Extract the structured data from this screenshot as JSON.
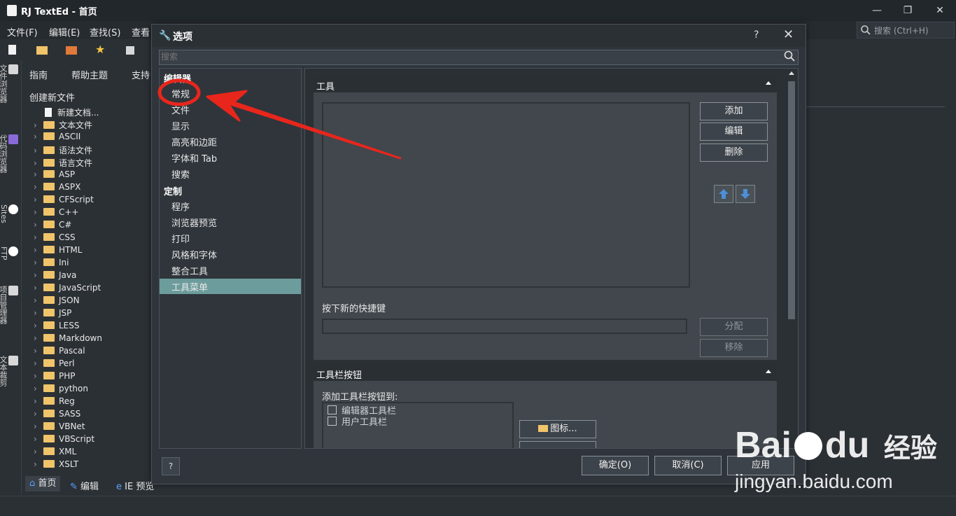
{
  "app": {
    "title": "RJ TextEd - 首页"
  },
  "menu": {
    "items": [
      "文件(F)",
      "编辑(E)",
      "查找(S)",
      "查看"
    ]
  },
  "search": {
    "placeholder": "搜索 (Ctrl+H)"
  },
  "side_tabs": [
    "文件浏览器",
    "代码浏览器",
    "Sites",
    "FTP",
    "项目管理器",
    "文本裁剪"
  ],
  "subbar": {
    "guide": "指南",
    "help": "帮助主题",
    "support": "支持"
  },
  "panel": {
    "create_label": "创建新文件",
    "new_doc": "新建文档...",
    "items": [
      "文本文件",
      "ASCII",
      "语法文件",
      "语言文件",
      "ASP",
      "ASPX",
      "CFScript",
      "C++",
      "C#",
      "CSS",
      "HTML",
      "Ini",
      "Java",
      "JavaScript",
      "JSON",
      "JSP",
      "LESS",
      "Markdown",
      "Pascal",
      "Perl",
      "PHP",
      "python",
      "Reg",
      "SASS",
      "VBNet",
      "VBScript",
      "XML",
      "XSLT"
    ]
  },
  "bottom_tabs": {
    "home": "首页",
    "edit": "编辑",
    "ie": "IE 预览"
  },
  "dialog": {
    "title": "选项",
    "help": "?",
    "search_placeholder": "搜索",
    "groups": {
      "editor": "编辑器",
      "custom": "定制"
    },
    "editor_items": [
      "常规",
      "文件",
      "显示",
      "高亮和边距",
      "字体和 Tab",
      "搜索"
    ],
    "custom_items": [
      "程序",
      "浏览器预览",
      "打印",
      "风格和字体",
      "整合工具",
      "工具菜单"
    ],
    "selected": "工具菜单",
    "tools_section": "工具",
    "buttons": {
      "add": "添加",
      "edit": "编辑",
      "delete": "删除",
      "assign": "分配",
      "remove": "移除"
    },
    "shortcut_label": "按下新的快捷键",
    "toolbar_section": "工具栏按钮",
    "toolbar_add_label": "添加工具栏按钮到:",
    "toolbar_options": [
      "编辑器工具栏",
      "用户工具栏"
    ],
    "icon_button": "图标...",
    "footer": {
      "help": "?",
      "ok": "确定(O)",
      "cancel": "取消(C)",
      "apply": "应用"
    }
  },
  "watermark": {
    "brand": "Bai",
    "brand2": "du",
    "cn": "经验",
    "url": "jingyan.baidu.com"
  },
  "colors": {
    "accent_selected": "#6c9c9b",
    "annotation": "#e8261c",
    "folder": "#f0c46a"
  }
}
